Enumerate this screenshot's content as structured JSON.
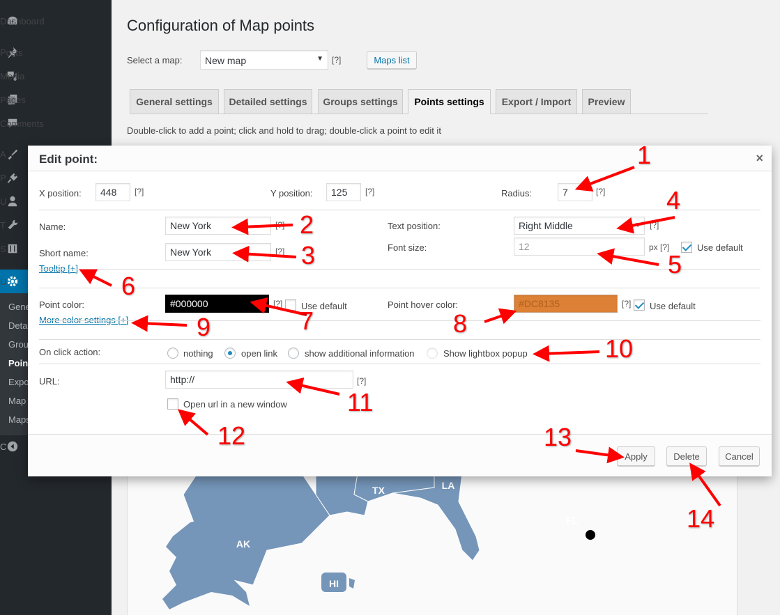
{
  "sidebar": {
    "items": [
      {
        "label": "Dashboard",
        "icon": "dashboard-icon"
      },
      {
        "label": "Posts",
        "icon": "pin-icon"
      },
      {
        "label": "Media",
        "icon": "media-icon"
      },
      {
        "label": "Pages",
        "icon": "pages-icon"
      },
      {
        "label": "Comments",
        "icon": "comment-icon"
      },
      {
        "label": "A",
        "icon": "brush-icon"
      },
      {
        "label": "P",
        "icon": "plugin-icon"
      },
      {
        "label": "U",
        "icon": "user-icon"
      },
      {
        "label": "T",
        "icon": "wrench-icon"
      },
      {
        "label": "S",
        "icon": "settings-sliders-icon"
      },
      {
        "label": "U",
        "icon": "gear-icon"
      }
    ],
    "submenu": [
      "Gene",
      "Deta",
      "Grou",
      "Point",
      "Expo",
      "Map",
      "Maps"
    ],
    "collapse_label": "C"
  },
  "page": {
    "title": "Configuration of Map points",
    "select_map_label": "Select a map:",
    "select_map_value": "New map",
    "help": "[?]",
    "maps_list_button": "Maps list",
    "tabs": [
      "General settings",
      "Detailed settings",
      "Groups settings",
      "Points settings",
      "Export / Import",
      "Preview"
    ],
    "active_tab": "Points settings",
    "hint": "Double-click to add a point; click and hold to drag; double-click a point to edit it"
  },
  "dialog": {
    "title": "Edit point:",
    "close": "×",
    "x_label": "X position:",
    "x_value": "448",
    "y_label": "Y position:",
    "y_value": "125",
    "radius_label": "Radius:",
    "radius_value": "7",
    "name_label": "Name:",
    "name_value": "New York",
    "short_name_label": "Short name:",
    "short_name_value": "New York",
    "tooltip_link": "Tooltip [+]",
    "text_position_label": "Text position:",
    "text_position_value": "Right Middle",
    "font_size_label": "Font size:",
    "font_size_value": "12",
    "px_help": "px [?]",
    "use_default": "Use default",
    "point_color_label": "Point color:",
    "point_color_value": "#000000",
    "more_color_link": "More color settings [+]",
    "hover_color_label": "Point hover color:",
    "hover_color_value": "#DC8135",
    "on_click_label": "On click action:",
    "on_click_options": [
      "nothing",
      "open link",
      "show additional information",
      "Show lightbox popup"
    ],
    "on_click_selected": "open link",
    "url_label": "URL:",
    "url_value": "http://",
    "open_new_window": "Open url in a new window",
    "apply": "Apply",
    "delete": "Delete",
    "cancel": "Cancel"
  },
  "colors": {
    "point_color": "#000000",
    "hover_color": "#DC8135",
    "map_fill": "#7596b9",
    "accent": "#0073aa"
  },
  "map": {
    "labels": [
      "TX",
      "LA",
      "FL",
      "AK",
      "HI"
    ]
  },
  "annotations": [
    "1",
    "2",
    "3",
    "4",
    "5",
    "6",
    "7",
    "8",
    "9",
    "10",
    "11",
    "12",
    "13",
    "14"
  ]
}
